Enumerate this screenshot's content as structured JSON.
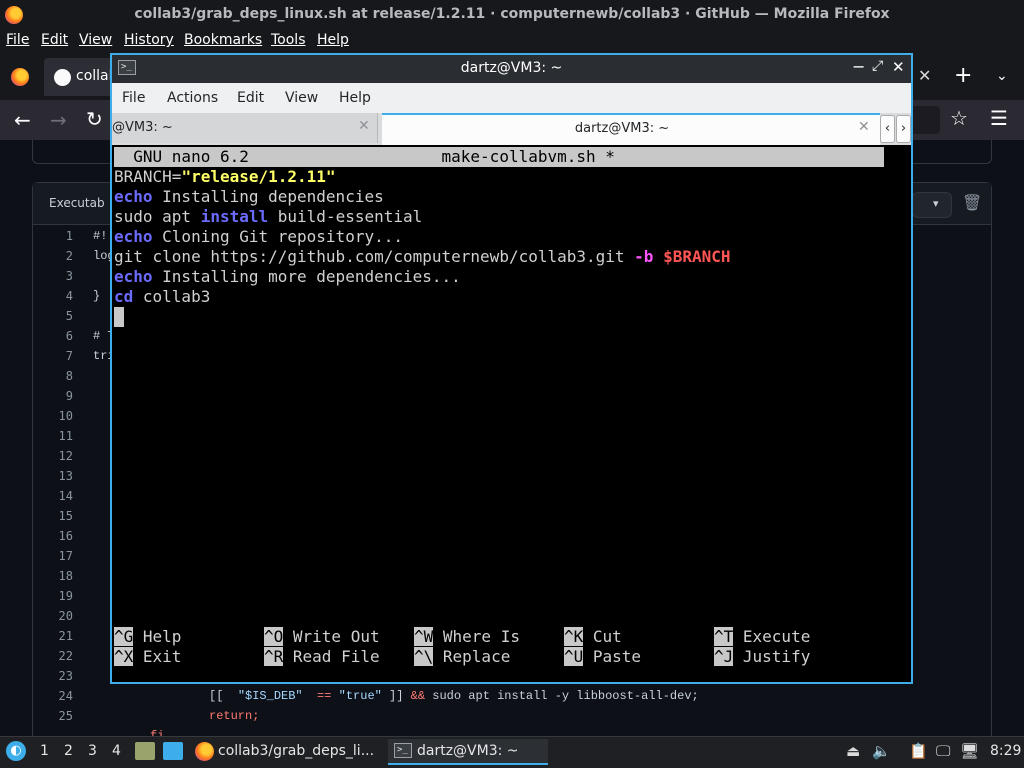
{
  "firefox": {
    "window_title": "collab3/grab_deps_linux.sh at release/1.2.11 · computernewb/collab3 · GitHub — Mozilla Firefox",
    "menu": [
      "File",
      "Edit",
      "View",
      "History",
      "Bookmarks",
      "Tools",
      "Help"
    ],
    "tab_label": "collab",
    "tab_close": "✕",
    "new_tab": "+",
    "tab_list": "⌄",
    "back": "←",
    "forward": "→",
    "reload": "↻",
    "bookmark_star": "☆",
    "app_menu": "☰"
  },
  "github": {
    "file_header_label": "Executab",
    "line_numbers": [
      "1",
      "2",
      "3",
      "4",
      "5",
      "6",
      "7",
      "8",
      "9",
      "10",
      "11",
      "12",
      "13",
      "14",
      "15",
      "16",
      "17",
      "18",
      "19",
      "20",
      "21",
      "22",
      "23",
      "24",
      "25"
    ],
    "code_fragments": {
      "l1": "#!",
      "l2": "log",
      "l4": "}",
      "l6": "# T",
      "l7": "tri",
      "l24_a": "[[  ",
      "l24_str": "\"$IS_DEB\"",
      "l24_b": "  ",
      "l24_eq": "==",
      "l24_c": " ",
      "l24_true": "\"true\"",
      "l24_d": " ]] ",
      "l24_and": "&&",
      "l24_e": " sudo apt install -y libboost-all-dev;",
      "l25": "return;",
      "l26": "fi"
    }
  },
  "terminal": {
    "title": "dartz@VM3: ~",
    "icon_glyph": ">_",
    "window_controls": {
      "minimize": "−",
      "maximize": "⤢",
      "close": "✕"
    },
    "menu": [
      "File",
      "Actions",
      "Edit",
      "View",
      "Help"
    ],
    "tabs": [
      {
        "label": "@VM3: ~",
        "close": "✕"
      },
      {
        "label": "dartz@VM3: ~",
        "close": "✕"
      }
    ],
    "tab_scroll_left": "‹",
    "tab_scroll_right": "›"
  },
  "nano": {
    "header": "  GNU nano 6.2                    make-collabvm.sh *                            ",
    "lines": {
      "l1_a": "BRANCH=",
      "l1_str": "\"release/1.2.11\"",
      "l2_kw": "echo",
      "l2_rest": " Installing dependencies",
      "l3_a": "sudo apt ",
      "l3_kw": "install",
      "l3_rest": " build-essential",
      "l4_kw": "echo",
      "l4_rest": " Cloning Git repository...",
      "l5_a": "git clone https://github.com/computernewb/collab3.git ",
      "l5_flag": "-b",
      "l5_b": " ",
      "l5_var": "$BRANCH",
      "l6_kw": "echo",
      "l6_rest": " Installing more dependencies...",
      "l7_kw": "cd",
      "l7_rest": " collab3"
    },
    "shortcuts": [
      [
        {
          "key": "^G",
          "label": " Help"
        },
        {
          "key": "^O",
          "label": " Write Out"
        },
        {
          "key": "^W",
          "label": " Where Is"
        },
        {
          "key": "^K",
          "label": " Cut"
        },
        {
          "key": "^T",
          "label": " Execute"
        }
      ],
      [
        {
          "key": "^X",
          "label": " Exit"
        },
        {
          "key": "^R",
          "label": " Read File"
        },
        {
          "key": "^\\",
          "label": " Replace"
        },
        {
          "key": "^U",
          "label": " Paste"
        },
        {
          "key": "^J",
          "label": " Justify"
        }
      ]
    ]
  },
  "taskbar": {
    "launcher_glyph": "◐",
    "desktops": [
      "1",
      "2",
      "3",
      "4"
    ],
    "firefox_task": "collab3/grab_deps_li...",
    "terminal_task": "dartz@VM3: ~",
    "terminal_icon_glyph": ">_",
    "tray": {
      "upload": "⏏",
      "volume": "🔈",
      "clipboard": "📋",
      "display": "🖵",
      "network": "🖥"
    },
    "clock": "8:29"
  },
  "colors": {
    "accent": "#3daee9",
    "nano_keyword": "#6b6bff",
    "nano_string": "#ffff66",
    "nano_flag": "#ff55ff",
    "nano_variable": "#ff5555"
  }
}
